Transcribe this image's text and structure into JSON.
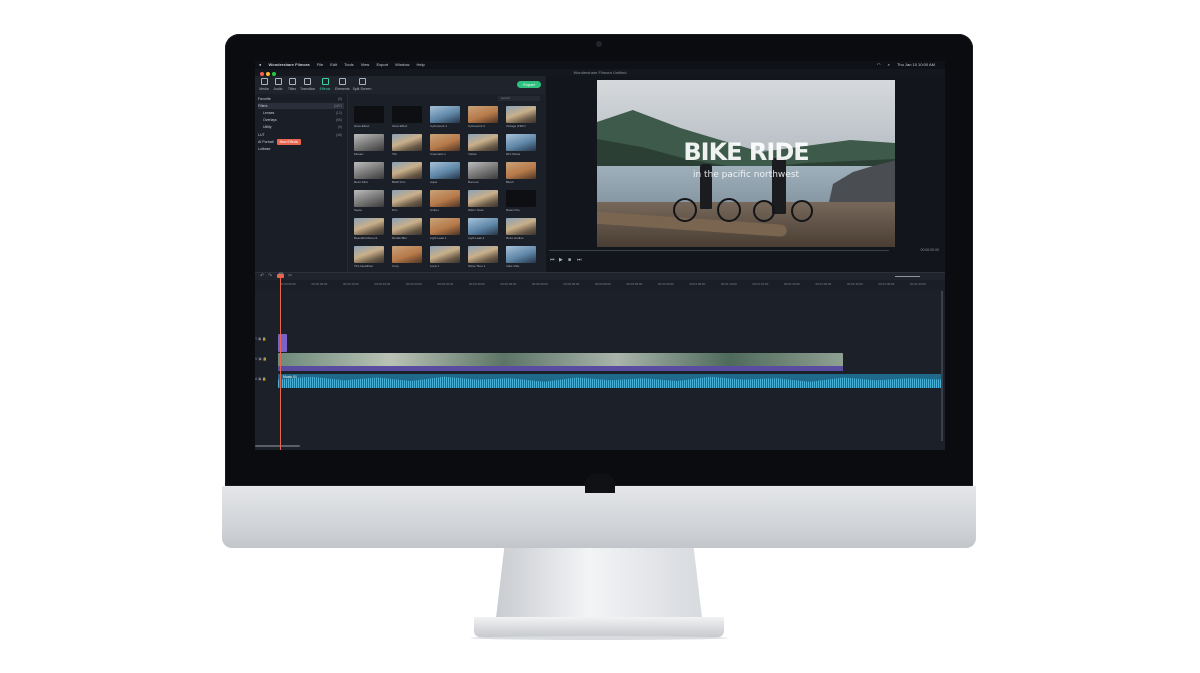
{
  "menubar": {
    "app": "Wondershare Filmora",
    "items": [
      "File",
      "Edit",
      "Tools",
      "View",
      "Export",
      "Window",
      "Help"
    ],
    "clock": "Thu Jan 10  10:00 AM"
  },
  "window": {
    "title": "Wondershare Filmora Untitled"
  },
  "toolbar": {
    "tabs": [
      "Media",
      "Audio",
      "Titles",
      "Transition",
      "Effects",
      "Elements",
      "Split Screen"
    ],
    "active_tab": "Effects",
    "export_label": "Export"
  },
  "sidebar": {
    "items": [
      {
        "label": "Favorite",
        "count": "(0)"
      },
      {
        "label": "Filters",
        "count": "(187)"
      },
      {
        "label": "Lenses",
        "count": "(12)"
      },
      {
        "label": "Overlays",
        "count": "(55)"
      },
      {
        "label": "Utility",
        "count": "(9)"
      },
      {
        "label": "LUT",
        "count": "(48)"
      },
      {
        "label": "AI Portrait",
        "count": ""
      },
      {
        "label": "Lutbase",
        "count": ""
      }
    ],
    "badge": "New Effects"
  },
  "library": {
    "search_placeholder": "search",
    "tiles": [
      "Glow Effect",
      "Glow Effect",
      "Cyberpunk 1",
      "Cyberpunk 2",
      "Vintage (1967)",
      "Mosaic",
      "70s",
      "Cinematic 1",
      "Yellow",
      "90's Movie",
      "Retro Mist",
      "B&W Film",
      "Aqua",
      "Burnout",
      "Blush",
      "Sepia",
      "Dim",
      "Amber",
      "Warm Glow",
      "Dawn Fire",
      "Beautiful Moment",
      "Rehab Blur",
      "Light Leak 1",
      "Light Leak 2",
      "Retro Hotline",
      "70's Headliner",
      "Cozy",
      "Luca 1",
      "Show Time 1",
      "Indie Vibe"
    ]
  },
  "preview": {
    "title": "Wondershare Filmora Untitled",
    "video_title": "BIKE RIDE",
    "video_subtitle": "in the pacific northwest",
    "timecode": "00:00:00:00",
    "controls": [
      "⏮",
      "▶",
      "■",
      "⏭"
    ]
  },
  "timeline": {
    "ruler": [
      "00:00:00:00",
      "00:00:05:00",
      "00:00:10:00",
      "00:00:15:00",
      "00:00:20:00",
      "00:00:25:00",
      "00:00:30:00",
      "00:00:35:00",
      "00:00:40:00",
      "00:00:45:00",
      "00:00:50:00",
      "00:00:55:00",
      "00:01:00:00",
      "00:01:05:00",
      "00:01:10:00",
      "00:01:15:00",
      "00:01:20:00",
      "00:01:25:00",
      "00:01:30:00",
      "00:01:35:00",
      "00:01:40:00"
    ],
    "audio_clip_label": "Music 01",
    "track_labels": [
      "T",
      "V",
      "A"
    ]
  }
}
